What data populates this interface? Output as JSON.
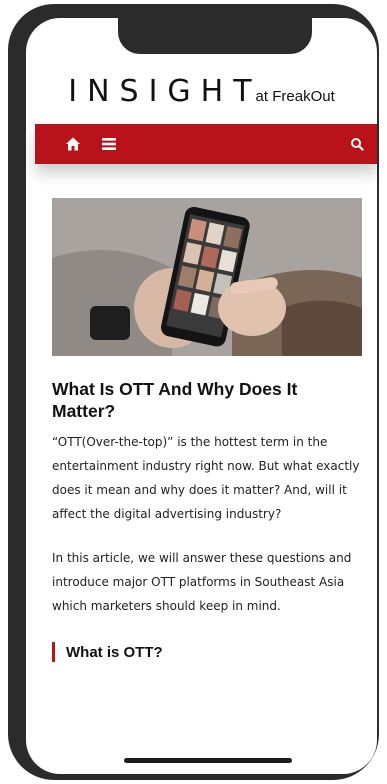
{
  "header": {
    "logo_main": "INSIGHT",
    "logo_sub": "at FreakOut"
  },
  "navbar": {
    "color": "#b8121a",
    "icons": [
      "home-icon",
      "menu-icon",
      "search-icon"
    ]
  },
  "article": {
    "title": "What Is OTT And Why Does It Matter?",
    "paragraphs": [
      "“OTT(Over-the-top)” is the hottest term in the entertainment industry right now. But what exactly does it mean and why does it matter? And, will it affect the digital advertising industry?",
      "In this article, we will answer these questions and introduce major OTT platforms in Southeast Asia which marketers should keep in mind."
    ],
    "section_heading": "What is OTT?"
  }
}
